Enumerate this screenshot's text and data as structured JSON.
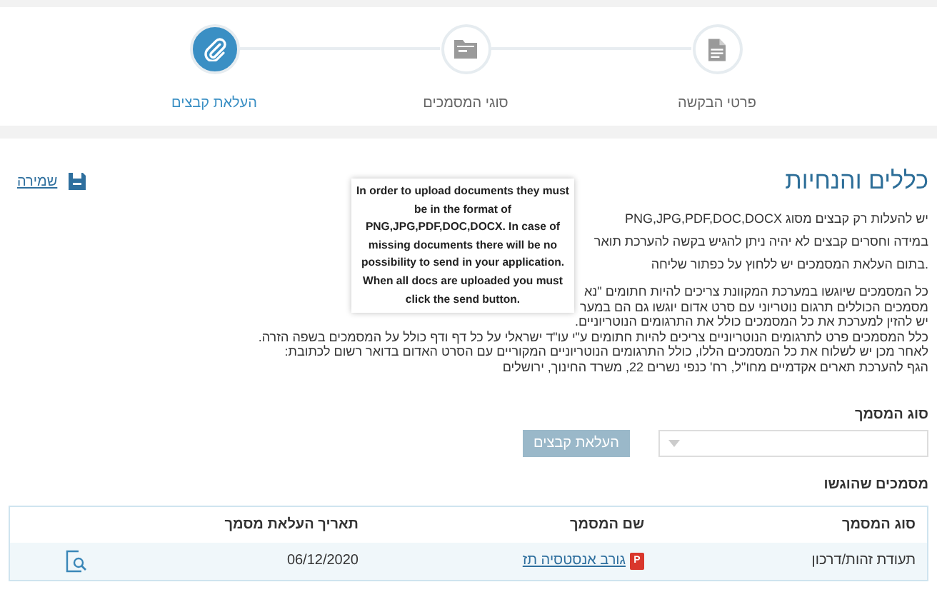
{
  "stepper": {
    "steps": [
      {
        "label": "פרטי הבקשה",
        "selected": false
      },
      {
        "label": "סוגי המסמכים",
        "selected": false
      },
      {
        "label": "העלאת קבצים",
        "selected": true
      }
    ]
  },
  "save_link": "שמירה",
  "heading": "כללים והנחיות",
  "intro_lines": [
    "יש להעלות רק קבצים מסוג PNG,JPG,PDF,DOC,DOCX",
    "במידה וחסרים קבצים לא יהיה ניתן להגיש בקשה להערכת תואר",
    ".בתום העלאת המסמכים יש ללחוץ על כפתור שליחה"
  ],
  "rules_lines": [
    "כל המסמכים שיוגשו במערכת המקוונת צריכים להיות חתומים \"נא",
    "מסמכים הכוללים תרגום נוטריוני עם סרט אדום יוגשו גם הם במער",
    "יש להזין למערכת את כל המסמכים כולל את התרגומים הנוטריוניים.",
    "כלל המסמכים פרט לתרגומים הנוטריוניים צריכים להיות חתומים ע\"י עו\"ד ישראלי על כל דף ודף כולל על המסמכים בשפה הזרה.",
    "לאחר מכן יש לשלוח את כל המסמכים הללו, כולל התרגומים הנוטריוניים המקוריים עם הסרט האדום בדואר רשום לכתובת:",
    "הגף להערכת תארים אקדמיים מחו\"ל, רח' כנפי נשרים 22, משרד החינוך, ירושלים"
  ],
  "tooltip": "In order to upload documents they must be in the format of PNG,JPG,PDF,DOC,DOCX. In case of missing documents there will be no possibility to send in your application. When all docs are uploaded you must click the send button.",
  "form": {
    "label": "סוג המסמך",
    "upload_button": {
      "label": "העלאת קבצים",
      "disabled": true
    }
  },
  "submitted_title": "מסמכים שהוגשו",
  "table": {
    "columns": [
      "סוג המסמך",
      "שם המסמך",
      "תאריך העלאת מסמך"
    ],
    "rows": [
      {
        "type": "תעודת זהות/דרכון",
        "file_badge": "P",
        "name": "גורב אנסטסיה תז",
        "date": "06/12/2020"
      }
    ]
  }
}
